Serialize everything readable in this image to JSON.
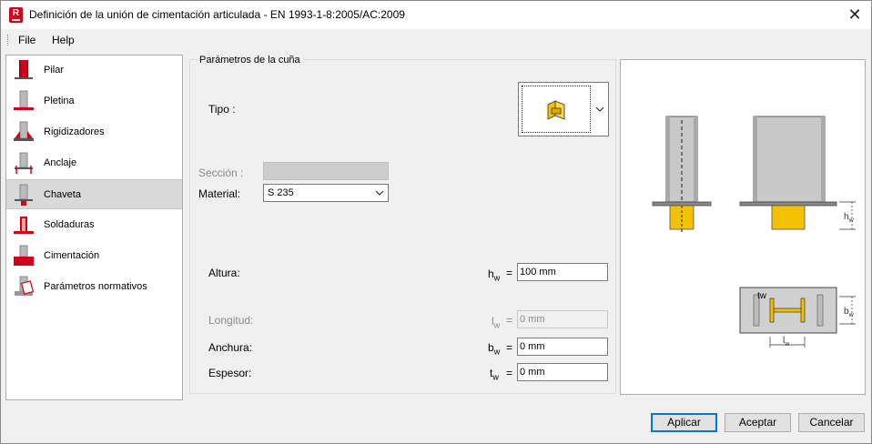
{
  "window": {
    "title": "Definición de la unión de cimentación articulada - EN 1993-1-8:2005/AC:2009",
    "app_icon_letter": "R",
    "close_glyph": "✕"
  },
  "menu": {
    "items": [
      "File",
      "Help"
    ]
  },
  "sidebar": {
    "selected_index": 4,
    "items": [
      {
        "label": "Pilar",
        "icon": "column-icon"
      },
      {
        "label": "Pletina",
        "icon": "base-plate-icon"
      },
      {
        "label": "Rigidizadores",
        "icon": "stiffeners-icon"
      },
      {
        "label": "Anclaje",
        "icon": "anchorage-icon"
      },
      {
        "label": "Chaveta",
        "icon": "shear-key-icon"
      },
      {
        "label": "Soldaduras",
        "icon": "welds-icon"
      },
      {
        "label": "Cimentación",
        "icon": "foundation-icon"
      },
      {
        "label": "Parámetros normativos",
        "icon": "code-parameters-icon"
      }
    ]
  },
  "panel": {
    "group_title": "Parámetros de la cuña",
    "tipo_label": "Tipo :",
    "seccion_label": "Sección :",
    "seccion_value": "",
    "material_label": "Material:",
    "material_value": "S 235",
    "altura_label": "Altura:",
    "altura_symbol": "h",
    "altura_sub": "w",
    "altura_value": "100 mm",
    "longitud_label": "Longitud:",
    "longitud_symbol": "l",
    "longitud_sub": "w",
    "longitud_value": "0 mm",
    "anchura_label": "Anchura:",
    "anchura_symbol": "b",
    "anchura_sub": "w",
    "anchura_value": "0 mm",
    "espesor_label": "Espesor:",
    "espesor_symbol": "t",
    "espesor_sub": "w",
    "espesor_value": "0 mm",
    "equals": "="
  },
  "preview": {
    "hw_label": "h",
    "bw_label": "b",
    "lw_label": "l",
    "tw_label": "tw",
    "sub": "w"
  },
  "buttons": {
    "apply": "Aplicar",
    "ok": "Aceptar",
    "cancel": "Cancelar"
  },
  "colors": {
    "accent": "#0078d7",
    "red": "#d0021b",
    "yellow": "#f2c100",
    "steel": "#b8b8b8"
  }
}
